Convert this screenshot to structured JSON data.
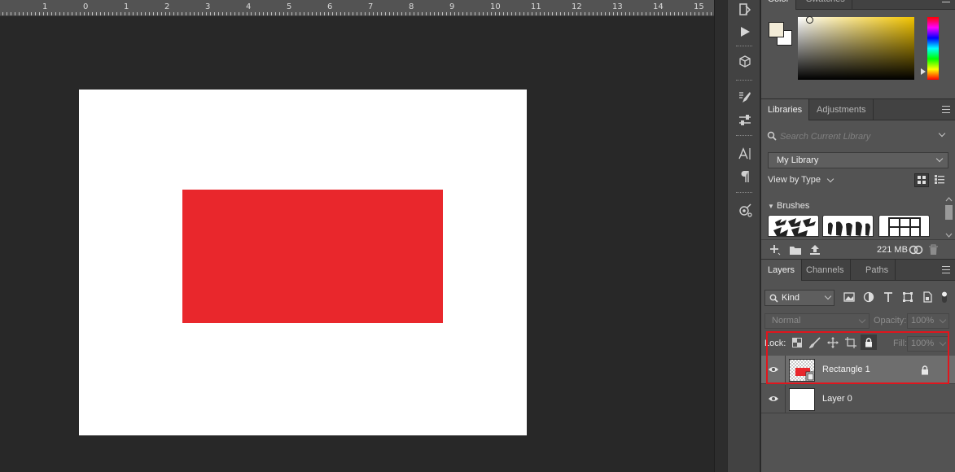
{
  "ruler": {
    "labels": [
      "1",
      "0",
      "1",
      "2",
      "3",
      "4",
      "5",
      "6",
      "7",
      "8",
      "9",
      "10",
      "11",
      "12",
      "13",
      "14",
      "15"
    ]
  },
  "canvas": {
    "document_color": "#ffffff",
    "shape_color": "#e9272c"
  },
  "color_panel": {
    "tabs": [
      "Color",
      "Swatches"
    ],
    "foreground": "#f3ecd8",
    "background": "#ffffff",
    "hue_color": "#f2c400"
  },
  "libraries_panel": {
    "tabs": [
      "Libraries",
      "Adjustments"
    ],
    "search_placeholder": "Search Current Library",
    "library_select": "My Library",
    "view_by_label": "View by Type",
    "section_label": "Brushes",
    "storage_size": "221 MB"
  },
  "layers_panel": {
    "tabs": [
      "Layers",
      "Channels",
      "Paths"
    ],
    "filter_label": "Kind",
    "blend_mode": "Normal",
    "opacity_label": "Opacity:",
    "opacity_value": "100%",
    "lock_label": "Lock:",
    "fill_label": "Fill:",
    "fill_value": "100%",
    "layers": [
      {
        "name": "Rectangle 1",
        "selected": true,
        "locked": true
      },
      {
        "name": "Layer 0",
        "selected": false,
        "locked": false
      }
    ]
  },
  "colors": {
    "highlight": "#e0151d",
    "panel_bg": "#535353",
    "dock_bg": "#424242",
    "canvas_bg": "#282828"
  },
  "icons": {
    "dock": [
      "history-icon",
      "play-actions-icon",
      "3d-icon",
      "brush-settings-icon",
      "adjust-icon",
      "character-icon",
      "paragraph-icon",
      "libraries-link-icon"
    ],
    "layer_filters": [
      "image-filter-icon",
      "adjustment-filter-icon",
      "type-filter-icon",
      "shape-filter-icon",
      "smart-object-filter-icon",
      "filter-toggle-icon"
    ],
    "locks": [
      "lock-transparent-icon",
      "lock-paint-icon",
      "lock-position-icon",
      "lock-artboard-icon",
      "lock-all-icon"
    ]
  }
}
